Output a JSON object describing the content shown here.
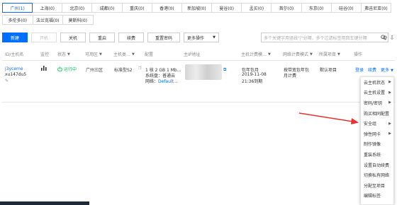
{
  "regions": {
    "row1": [
      "广州(1)",
      "上海(0)",
      "北京(0)",
      "成都(0)",
      "重庆(0)",
      "香港(0)",
      "新加坡(0)",
      "曼谷(0)",
      "孟买(0)",
      "首尔(0)",
      "东京(0)",
      "硅谷(0)",
      "弗吉尼亚(0)"
    ],
    "row2": [
      "多伦多(0)",
      "法兰克福(0)",
      "莫斯科(0)"
    ],
    "active_index": 0
  },
  "toolbar": {
    "new": "新建",
    "start": "开机",
    "shutdown": "关机",
    "restart": "重启",
    "renew": "续费",
    "reset_password": "重置密码",
    "more": "更多操作",
    "search_placeholder": "多个关键字用竖线\"|\"分隔，多个过滤标签用回车键分隔"
  },
  "table": {
    "headers": {
      "id": "ID/主机名",
      "monitor": "监控",
      "status": "状态",
      "zone": "可用区",
      "type": "主机类…",
      "config": "配置",
      "ip": "主IP地址",
      "billing": "主机计费模…",
      "net_billing": "网络计费模式",
      "project": "所属项目",
      "ops": "操作"
    },
    "row": {
      "id": "j3yceme",
      "hostname": "xu147du5",
      "status": "运行中",
      "zone": "广州三区",
      "type": "标准型S2",
      "config_line1": "1 核 2 GB 1 Mb...",
      "config_line2": "系统盘：普通云",
      "config_line3_label": "网络：",
      "config_line3_value": "Default...",
      "billing_line1": "包年包月",
      "billing_line2": "2019-11-08",
      "billing_line3": "21:36到期",
      "net_billing_line1": "按带宽包年包",
      "net_billing_line2": "月计费",
      "project": "默认项目",
      "op_login": "登录",
      "op_renew": "续费",
      "op_more": "更多"
    }
  },
  "menu": {
    "items": [
      {
        "label": "云主机状态",
        "submenu": true
      },
      {
        "label": "云主机设置",
        "submenu": true
      },
      {
        "label": "密码/密钥",
        "submenu": true
      },
      {
        "label": "购买相同配置",
        "submenu": false
      },
      {
        "label": "安全组",
        "submenu": true
      },
      {
        "label": "弹性网卡",
        "submenu": true
      },
      {
        "label": "制作镜像",
        "submenu": false
      },
      {
        "label": "重装系统",
        "submenu": false
      },
      {
        "label": "设置自动续费",
        "submenu": false
      },
      {
        "label": "切换私有网络",
        "submenu": false
      },
      {
        "label": "分配至项目",
        "submenu": false
      },
      {
        "label": "编辑标签",
        "submenu": false
      }
    ]
  },
  "colors": {
    "accent": "#006eff",
    "running": "#0abf5b",
    "annotation": "#e8322f"
  }
}
